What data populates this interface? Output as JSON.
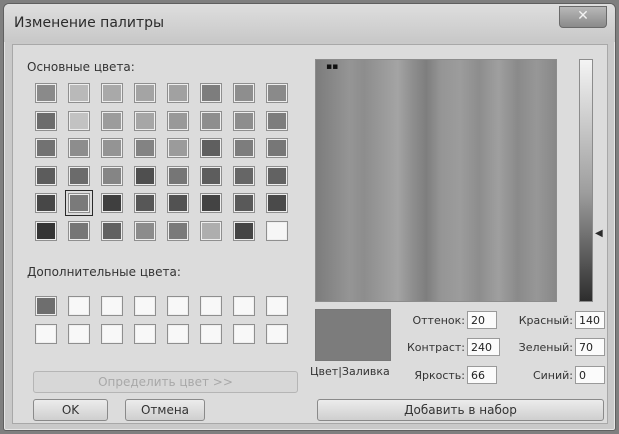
{
  "window": {
    "title": "Изменение палитры",
    "close_glyph": "✕"
  },
  "basic_colors": {
    "label": "Основные цвета:",
    "rows": [
      [
        "#8a8a8a",
        "#b9b9b9",
        "#a9a9a9",
        "#a4a4a4",
        "#a1a1a1",
        "#7d7d7d",
        "#8e8e8e",
        "#8a8a8a"
      ],
      [
        "#6c6c6c",
        "#c2c2c2",
        "#9c9c9c",
        "#a6a6a6",
        "#999999",
        "#8e8e8e",
        "#8d8d8d",
        "#7d7d7d"
      ],
      [
        "#727272",
        "#8d8d8d",
        "#949494",
        "#838383",
        "#9b9b9b",
        "#5f5f5f",
        "#7d7d7d",
        "#777777"
      ],
      [
        "#5c5c5c",
        "#6b6b6b",
        "#858585",
        "#4f4f4f",
        "#767676",
        "#5d5d5d",
        "#666666",
        "#626262"
      ],
      [
        "#474747",
        "#7a7a7a",
        "#3f3f3f",
        "#575757",
        "#525252",
        "#434343",
        "#595959",
        "#4a4a4a"
      ],
      [
        "#353535",
        "#767676",
        "#616161",
        "#8c8c8c",
        "#7a7a7a",
        "#aeaeae",
        "#454545",
        "#f6f6f6"
      ]
    ],
    "selected_row": 4,
    "selected_col": 1
  },
  "custom_colors": {
    "label": "Дополнительные цвета:",
    "rows": [
      [
        "#6e6e6e",
        "#f8f8f8",
        "#f8f8f8",
        "#f8f8f8",
        "#f8f8f8",
        "#f8f8f8",
        "#f8f8f8",
        "#f8f8f8"
      ],
      [
        "#f8f8f8",
        "#f8f8f8",
        "#f8f8f8",
        "#f8f8f8",
        "#f8f8f8",
        "#f8f8f8",
        "#f8f8f8",
        "#f8f8f8"
      ]
    ]
  },
  "define_button": "Определить цвет >>",
  "ok_button": "OK",
  "cancel_button": "Отмена",
  "preview": {
    "label": "Цвет|Заливка",
    "color": "#7c7c7c"
  },
  "fields": {
    "hue_label": "Оттенок:",
    "hue_value": "20",
    "sat_label": "Контраст:",
    "sat_value": "240",
    "lum_label": "Яркость:",
    "lum_value": "66",
    "red_label": "Красный:",
    "red_value": "140",
    "green_label": "Зеленый:",
    "green_value": "70",
    "blue_label": "Синий:",
    "blue_value": "0"
  },
  "add_button": "Добавить в набор",
  "luminance_level": 0.73
}
